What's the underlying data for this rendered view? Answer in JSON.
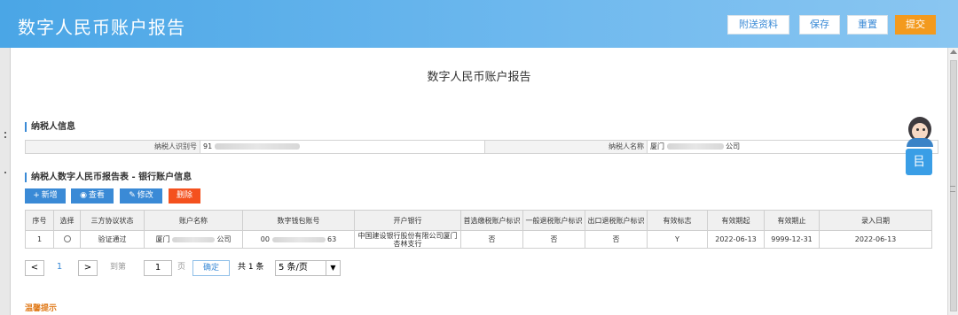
{
  "header": {
    "title": "数字人民币账户报告",
    "buttons": {
      "attach": "附送资料",
      "save": "保存",
      "reset": "重置",
      "submit": "提交"
    }
  },
  "page_title": "数字人民币账户报告",
  "taxpayer_section": {
    "title": "纳税人信息",
    "id_label": "纳税人识别号",
    "id_value_visible": "91",
    "name_label": "纳税人名称",
    "name_prefix_visible": "厦门",
    "name_suffix_visible": "公司"
  },
  "report_section": {
    "title": "纳税人数字人民币报告表 - 银行账户信息",
    "toolbar": {
      "add": "新增",
      "view": "查看",
      "edit": "修改",
      "delete": "删除"
    }
  },
  "table": {
    "headers": [
      "序号",
      "选择",
      "三方协议状态",
      "账户名称",
      "数字钱包账号",
      "开户银行",
      "首选缴税账户标识",
      "一般退税账户标识",
      "出口退税账户标识",
      "有效标志",
      "有效期起",
      "有效期止",
      "录入日期"
    ],
    "rows": [
      {
        "index": "1",
        "agreement_status": "验证通过",
        "account_name_prefix": "厦门",
        "account_name_suffix": "公司",
        "wallet_prefix": "00",
        "wallet_suffix": "63",
        "bank": "中国建设银行股份有限公司厦门杏林支行",
        "preferred_tax": "否",
        "general_refund": "否",
        "export_refund": "否",
        "valid_flag": "Y",
        "valid_from": "2022-06-13",
        "valid_to": "9999-12-31",
        "entry_date": "2022-06-13"
      }
    ]
  },
  "pager": {
    "prev": "<",
    "current_page": "1",
    "next": ">",
    "goto_label": "到第",
    "page_input": "1",
    "page_unit": "页",
    "confirm": "确定",
    "total": "共 1 条",
    "page_size": "5 条/页"
  },
  "warm_tip": "温馨提示",
  "service_icon_glyph": "㠯",
  "colors": {
    "header": "#4aa6e6",
    "primary": "#3a8ad6",
    "submit": "#f39a1e",
    "delete": "#f4511e",
    "warm": "#e07a1a"
  }
}
